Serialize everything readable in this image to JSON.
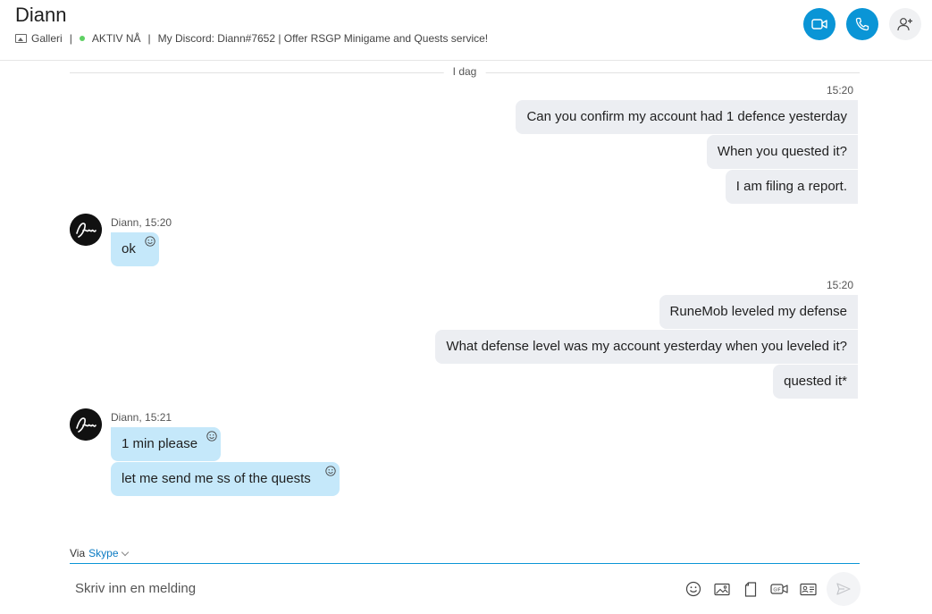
{
  "header": {
    "contact_name": "Diann",
    "gallery_label": "Galleri",
    "status_label": "AKTIV NÅ",
    "mood_message": "My Discord: Diann#7652 | Offer RSGP Minigame and Quests service!",
    "separator": "|",
    "video_icon": "video-camera-icon",
    "call_icon": "phone-icon",
    "add_icon": "add-person-icon",
    "accent_color": "#0a95d6",
    "status_color": "#5ed063"
  },
  "chat": {
    "date_divider": "I dag",
    "groups": [
      {
        "direction": "out",
        "time": "15:20",
        "messages": [
          "Can you confirm my account had 1 defence yesterday",
          "When you quested it?",
          "I am filing a report."
        ]
      },
      {
        "direction": "in",
        "sender": "Diann,",
        "time": "15:20",
        "messages": [
          "ok"
        ]
      },
      {
        "direction": "out",
        "time": "15:20",
        "messages": [
          "RuneMob leveled my defense",
          "What defense level was my account yesterday when you leveled it?",
          "quested it*"
        ]
      },
      {
        "direction": "in",
        "sender": "Diann,",
        "time": "15:21",
        "messages": [
          "1 min please",
          "let me send me ss of the quests"
        ]
      }
    ],
    "outgoing_bubble_color": "#eceef2",
    "incoming_bubble_color": "#c5e8fa"
  },
  "composer": {
    "via_label": "Via",
    "via_service": "Skype",
    "placeholder": "Skriv inn en melding",
    "tools": [
      "emoji-icon",
      "image-icon",
      "file-icon",
      "gif-icon",
      "contact-card-icon"
    ],
    "send_icon": "send-icon"
  }
}
